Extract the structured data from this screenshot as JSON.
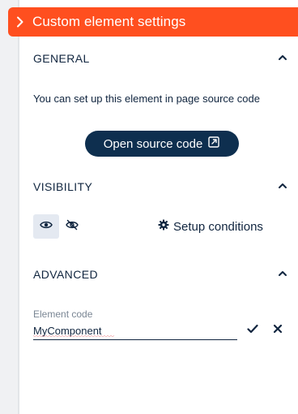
{
  "panel": {
    "title": "Custom element settings"
  },
  "general": {
    "title": "GENERAL",
    "description": "You can set up this element in page source code",
    "open_source_label": "Open source code"
  },
  "visibility": {
    "title": "VISIBILITY",
    "setup_conditions_label": "Setup conditions",
    "selected": "visible"
  },
  "advanced": {
    "title": "ADVANCED",
    "element_code_label": "Element code",
    "element_code_value": "MyComponent"
  },
  "colors": {
    "header_bg": "#ff4f1f",
    "primary": "#0e2f4f",
    "text": "#10253f"
  }
}
